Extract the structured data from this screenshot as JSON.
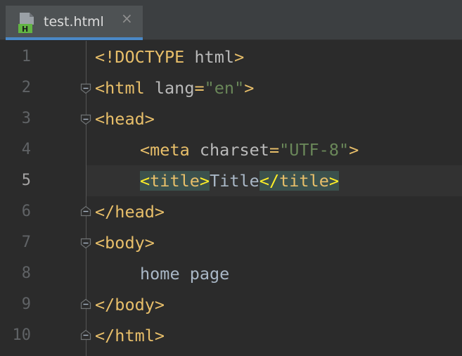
{
  "tab": {
    "icon": "html-file-icon",
    "label": "test.html",
    "close_glyph": "×"
  },
  "colors": {
    "background": "#2b2b2b",
    "tag": "#e8bf6a",
    "attribute": "#bababa",
    "string": "#6a8759",
    "text": "#a9b7c6",
    "tab_underline": "#4a88c7",
    "match_highlight": "#3b514d"
  },
  "editor": {
    "current_line": 5,
    "lines": [
      {
        "number": "1",
        "code": "<!DOCTYPE html>"
      },
      {
        "number": "2",
        "code": "<html lang=\"en\">"
      },
      {
        "number": "3",
        "code": "<head>"
      },
      {
        "number": "4",
        "code": "<meta charset=\"UTF-8\">"
      },
      {
        "number": "5",
        "code": "<title>Title</title>"
      },
      {
        "number": "6",
        "code": "</head>"
      },
      {
        "number": "7",
        "code": "<body>"
      },
      {
        "number": "8",
        "code": "home page"
      },
      {
        "number": "9",
        "code": "</body>"
      },
      {
        "number": "10",
        "code": "</html>"
      }
    ]
  }
}
